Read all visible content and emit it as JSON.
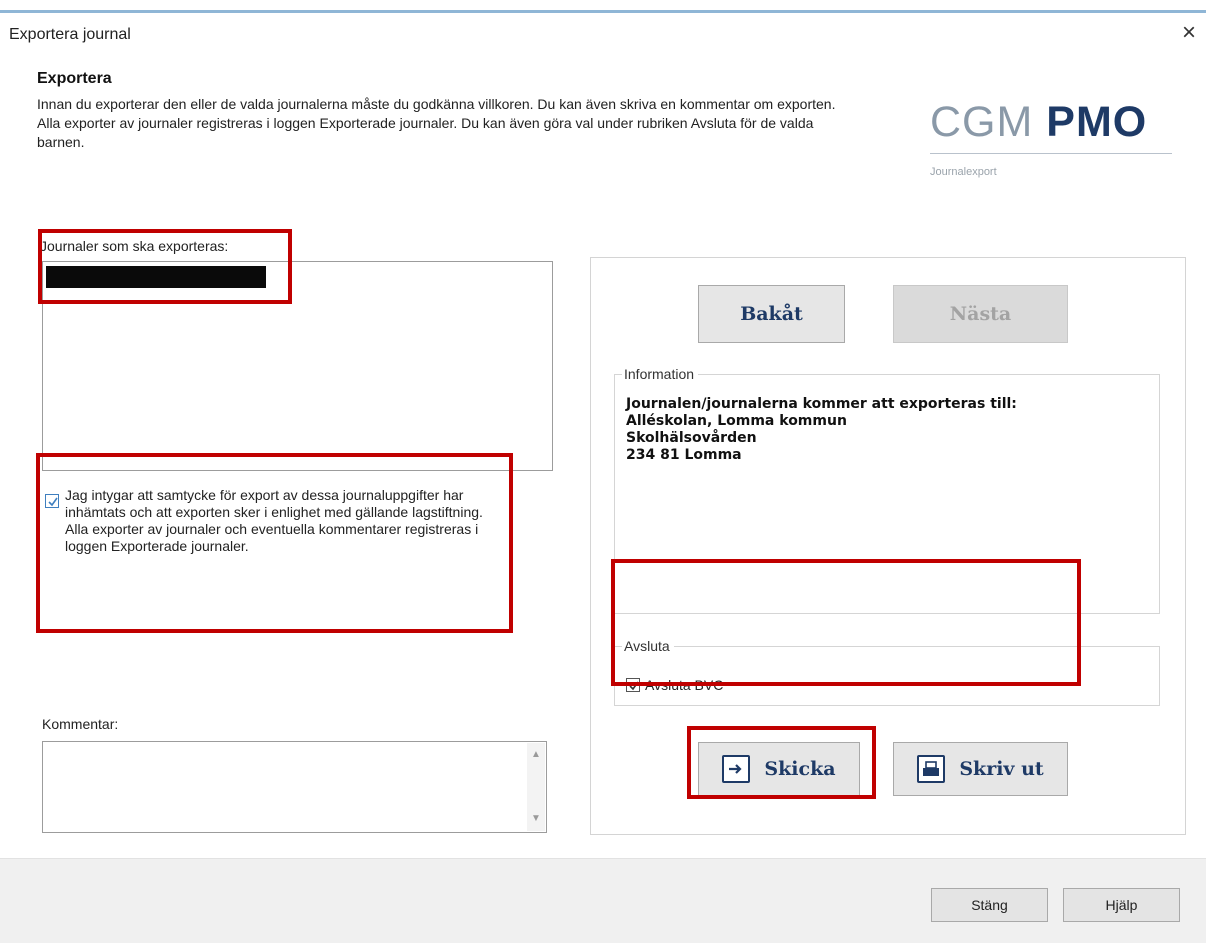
{
  "window": {
    "title": "Exportera journal",
    "close_glyph": "×"
  },
  "header": {
    "title": "Exportera",
    "description": "Innan du exporterar den eller de valda journalerna måste du godkänna villkoren. Du kan även skriva en kommentar om exporten. Alla exporter av journaler registreras i loggen Exporterade journaler. Du kan även göra val under rubriken Avsluta för de valda barnen."
  },
  "logo": {
    "part1": "CGM",
    "part2": "PMO",
    "subtitle": "Journalexport"
  },
  "journals": {
    "label": "Journaler som ska exporteras:",
    "items_redacted": true
  },
  "consent": {
    "checked": true,
    "text": "Jag intygar att samtycke för export av dessa journaluppgifter har inhämtats och att exporten sker i enlighet med gällande lagstiftning.\nAlla exporter av journaler och eventuella kommentarer registreras i loggen Exporterade journaler."
  },
  "comment": {
    "label": "Kommentar:",
    "value": ""
  },
  "nav": {
    "back_label": "Bakåt",
    "next_label": "Nästa",
    "next_disabled": true
  },
  "information": {
    "label": "Information",
    "lines": [
      "Journalen/journalerna kommer att exporteras till:",
      "Alléskolan, Lomma kommun",
      "Skolhälsovården",
      "234 81 Lomma"
    ]
  },
  "avsluta": {
    "label": "Avsluta",
    "checkbox_label": "Avsluta BVC",
    "checked": true
  },
  "actions": {
    "send_label": "Skicka",
    "print_label": "Skriv ut"
  },
  "footer": {
    "close_label": "Stäng",
    "help_label": "Hjälp"
  },
  "colors": {
    "accent": "#1e3a66",
    "highlight": "#c00000",
    "title_line": "#8fb6d6"
  }
}
